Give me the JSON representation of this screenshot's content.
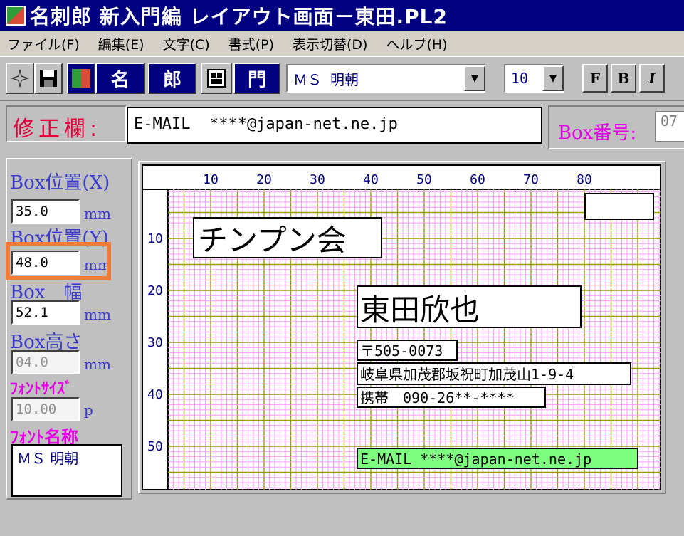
{
  "window": {
    "title": "名刺郎 新入門編 レイアウト画面－東田.PL2"
  },
  "menu": [
    "ファイル(F)",
    "編集(E)",
    "文字(C)",
    "書式(P)",
    "表示切替(D)",
    "ヘルプ(H)"
  ],
  "toolbar": {
    "banner_left": "名",
    "banner_mid": "郎",
    "banner_right": "門",
    "font_name": "ＭＳ 明朝",
    "font_size": "10",
    "btn_f": "F",
    "btn_b": "B",
    "btn_i": "I"
  },
  "edit": {
    "label": "修正欄:",
    "value": "E-MAIL  ****@japan-net.ne.jp",
    "box_no_label": "Box番号:",
    "box_no_value": "07"
  },
  "panel": {
    "pos_x_label": "Box位置(X)",
    "pos_x_value": "35.0",
    "pos_y_label": "Box位置(Y)",
    "pos_y_value": "48.0",
    "width_label": "Box　幅",
    "width_value": "52.1",
    "height_label": "Box高さ",
    "height_value": "04.0",
    "font_size_label": "ﾌｫﾝﾄｻｲｽﾞ",
    "font_size_value": "10.00",
    "font_size_unit": "p",
    "font_name_label": "ﾌｫﾝﾄ名称",
    "font_name_value": "ＭＳ 明朝",
    "unit": "mm"
  },
  "ruler": {
    "x_ticks": [
      "10",
      "20",
      "30",
      "40",
      "50",
      "60",
      "70",
      "80"
    ],
    "y_ticks": [
      "10",
      "20",
      "30",
      "40",
      "50"
    ]
  },
  "card": {
    "org": "チンプン会",
    "name": "東田欣也",
    "postal": "〒505-0073",
    "address": "岐阜県加茂郡坂祝町加茂山1-9-4",
    "mobile": "携帯　090-26**-****",
    "email": "E-MAIL  ****@japan-net.ne.jp"
  },
  "colors": {
    "titlebar": "#000080",
    "grid_bg": "#ffffff",
    "grid_minor": "#ff99ff",
    "grid_major": "#999900",
    "selected_box": "#7fff7f",
    "highlight": "#f07c3c"
  }
}
